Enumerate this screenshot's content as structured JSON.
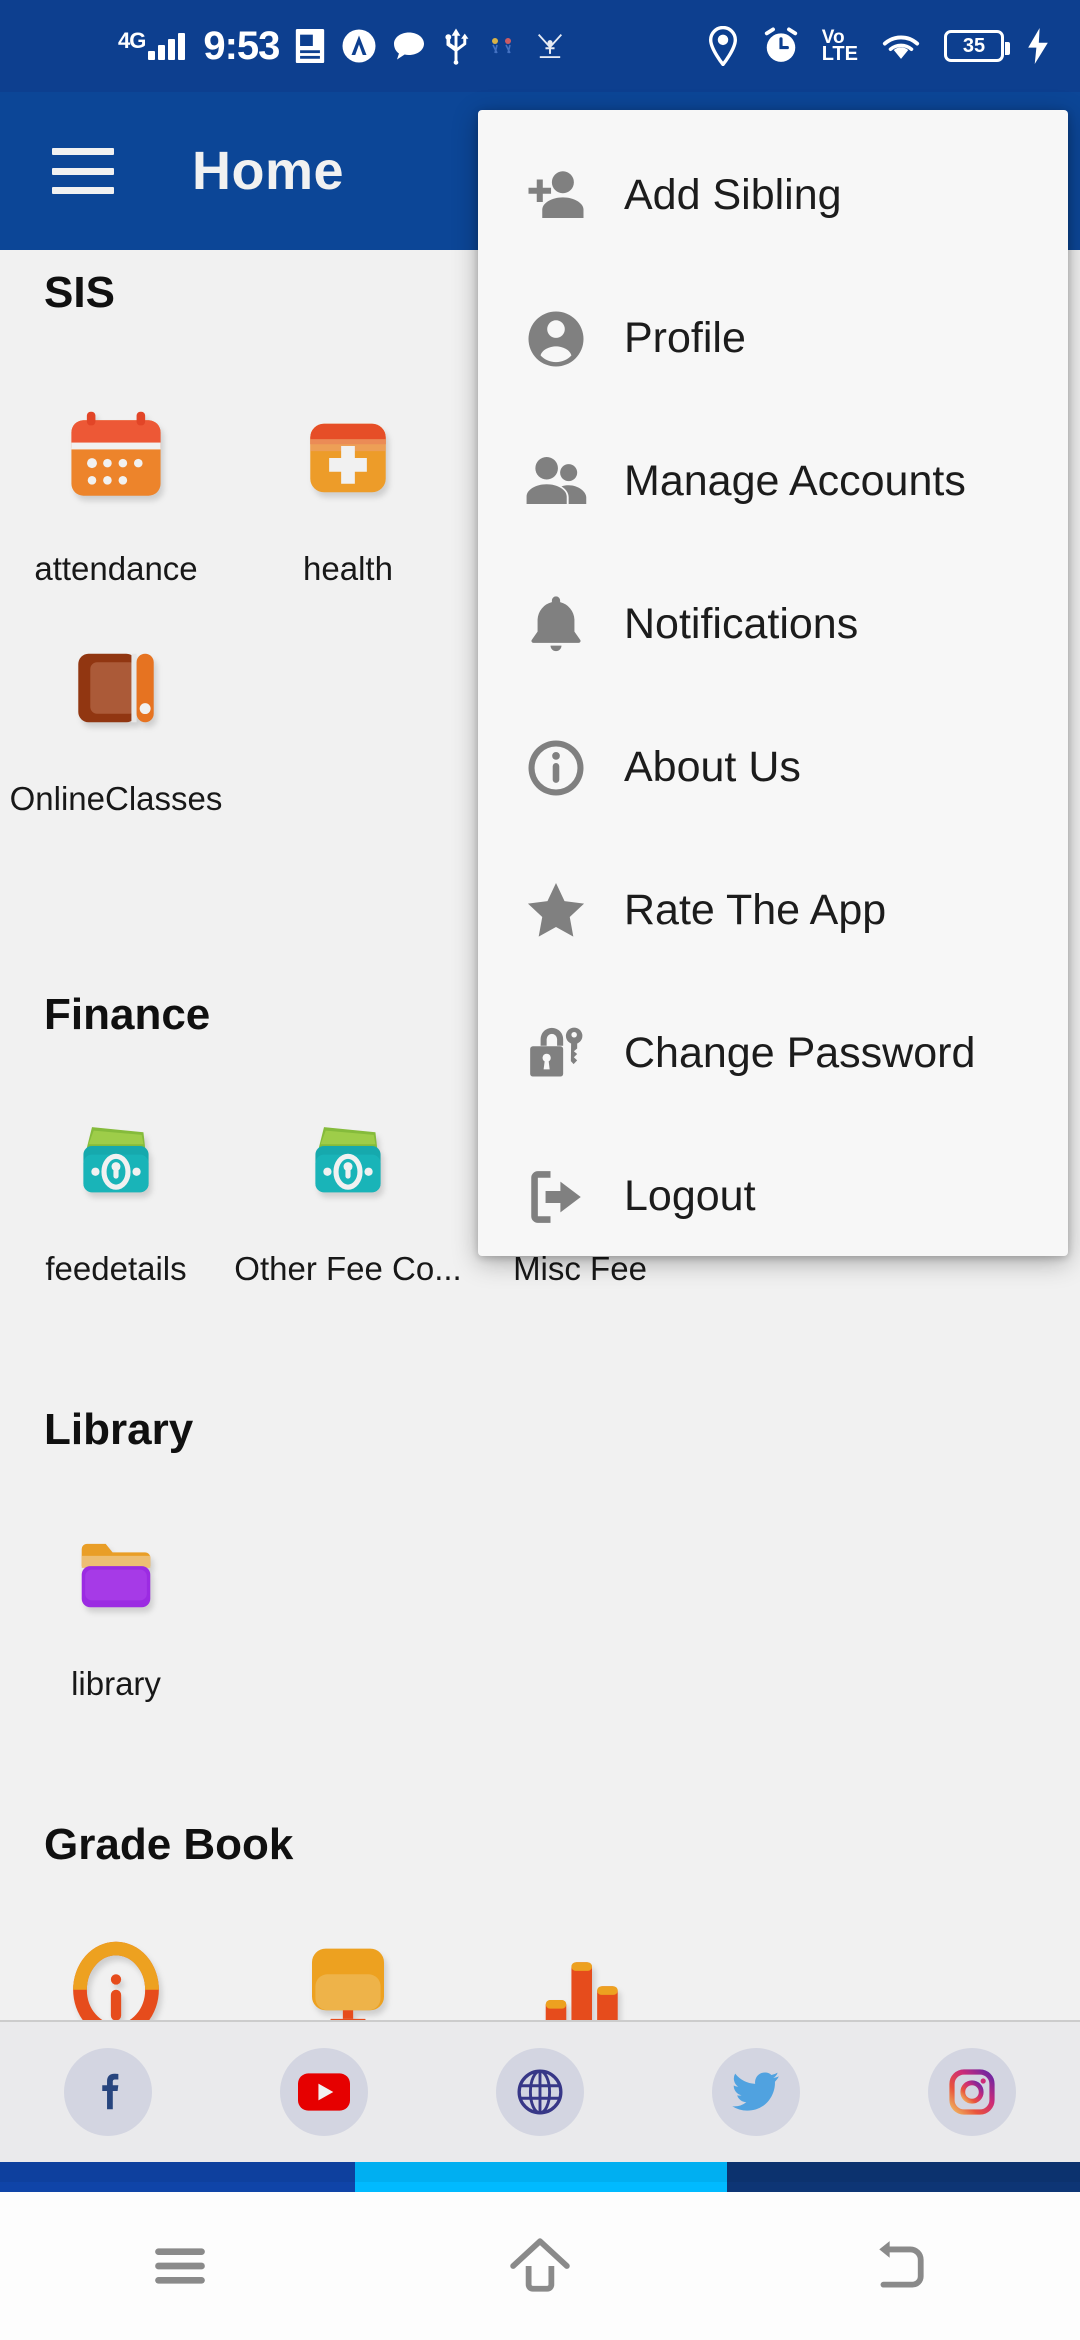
{
  "status_bar": {
    "network_type": "4G",
    "time": "9:53",
    "battery_level": "35",
    "volte_line1": "Vo",
    "volte_line2": "LTE",
    "left_icons": [
      "signal-bars-icon",
      "document-icon",
      "a-logo-icon",
      "chat-bubble-icon",
      "usb-icon",
      "app-icon-small",
      "vikas-logo-icon"
    ],
    "right_icons": [
      "location-pin-icon",
      "alarm-clock-icon",
      "volte-icon",
      "wifi-icon",
      "battery-icon",
      "charging-bolt-icon"
    ]
  },
  "app_bar": {
    "menu_icon": "hamburger-icon",
    "title": "Home"
  },
  "overflow_menu": {
    "items": [
      {
        "label": "Add Sibling",
        "icon": "person-add-icon"
      },
      {
        "label": "Profile",
        "icon": "account-circle-icon"
      },
      {
        "label": "Manage Accounts",
        "icon": "people-icon"
      },
      {
        "label": "Notifications",
        "icon": "bell-icon"
      },
      {
        "label": "About Us",
        "icon": "info-circle-icon"
      },
      {
        "label": "Rate The App",
        "icon": "star-icon"
      },
      {
        "label": "Change Password",
        "icon": "lock-key-icon"
      },
      {
        "label": "Logout",
        "icon": "logout-icon"
      }
    ]
  },
  "sections": [
    {
      "title": "SIS",
      "rows": [
        [
          {
            "label": "attendance",
            "icon": "calendar-icon"
          },
          {
            "label": "health",
            "icon": "first-aid-kit-icon"
          }
        ],
        [
          {
            "label": "OnlineClasses",
            "icon": "online-classes-icon"
          }
        ]
      ]
    },
    {
      "title": "Finance",
      "rows": [
        [
          {
            "label": "feedetails",
            "icon": "money-wallet-icon"
          },
          {
            "label": "Other Fee Co...",
            "icon": "money-wallet-icon"
          },
          {
            "label": "Misc Fee",
            "icon": "money-wallet-icon"
          }
        ]
      ]
    },
    {
      "title": "Library",
      "rows": [
        [
          {
            "label": "library",
            "icon": "folder-icon"
          }
        ]
      ]
    },
    {
      "title": "Grade Book",
      "rows": [
        [
          {
            "label": "",
            "icon": "info-circle-orange-icon"
          },
          {
            "label": "",
            "icon": "monitor-icon"
          },
          {
            "label": "",
            "icon": "bar-chart-icon"
          }
        ]
      ]
    }
  ],
  "social_bar": {
    "items": [
      {
        "name": "facebook-icon"
      },
      {
        "name": "youtube-icon"
      },
      {
        "name": "website-globe-icon"
      },
      {
        "name": "twitter-icon"
      },
      {
        "name": "instagram-icon"
      }
    ]
  },
  "nav_bar": {
    "buttons": [
      {
        "name": "recents-button"
      },
      {
        "name": "home-button"
      },
      {
        "name": "back-button"
      }
    ]
  },
  "colors": {
    "status_bar": "#0d3f8f",
    "app_bar": "#0d4ba0",
    "strip_blue": "#0f44a8",
    "strip_cyan": "#00baff",
    "strip_darkblue": "#0d3575",
    "menu_bg": "#f7f7f7",
    "menu_icon": "#808080"
  }
}
